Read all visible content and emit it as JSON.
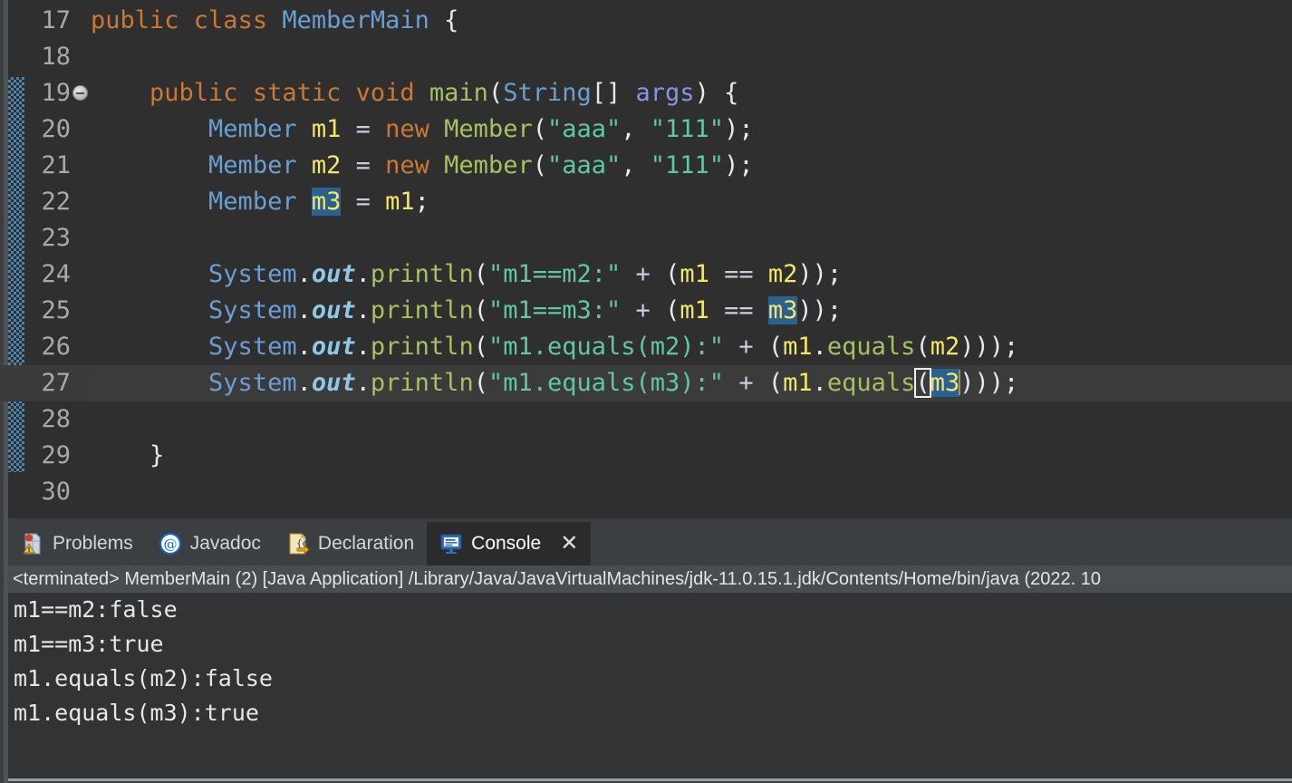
{
  "editor": {
    "lines": [
      {
        "num": "17",
        "fold": false,
        "current": false,
        "tokens": [
          {
            "t": "public ",
            "c": "kw"
          },
          {
            "t": "class ",
            "c": "kw"
          },
          {
            "t": "MemberMain",
            "c": "type"
          },
          {
            "t": " {",
            "c": "plain"
          }
        ]
      },
      {
        "num": "18",
        "fold": false,
        "current": false,
        "tokens": []
      },
      {
        "num": "19",
        "fold": true,
        "current": false,
        "tokens": [
          {
            "t": "    ",
            "c": "plain"
          },
          {
            "t": "public ",
            "c": "kw"
          },
          {
            "t": "static ",
            "c": "kw"
          },
          {
            "t": "void ",
            "c": "kw"
          },
          {
            "t": "main",
            "c": "method"
          },
          {
            "t": "(",
            "c": "plain"
          },
          {
            "t": "String",
            "c": "type"
          },
          {
            "t": "[] ",
            "c": "plain"
          },
          {
            "t": "args",
            "c": "param"
          },
          {
            "t": ") {",
            "c": "plain"
          }
        ]
      },
      {
        "num": "20",
        "fold": false,
        "current": false,
        "tokens": [
          {
            "t": "        ",
            "c": "plain"
          },
          {
            "t": "Member ",
            "c": "type"
          },
          {
            "t": "m1",
            "c": "var"
          },
          {
            "t": " = ",
            "c": "op"
          },
          {
            "t": "new ",
            "c": "kw"
          },
          {
            "t": "Member",
            "c": "method"
          },
          {
            "t": "(",
            "c": "plain"
          },
          {
            "t": "\"aaa\"",
            "c": "str"
          },
          {
            "t": ", ",
            "c": "plain"
          },
          {
            "t": "\"111\"",
            "c": "str"
          },
          {
            "t": ");",
            "c": "plain"
          }
        ]
      },
      {
        "num": "21",
        "fold": false,
        "current": false,
        "tokens": [
          {
            "t": "        ",
            "c": "plain"
          },
          {
            "t": "Member ",
            "c": "type"
          },
          {
            "t": "m2",
            "c": "var"
          },
          {
            "t": " = ",
            "c": "op"
          },
          {
            "t": "new ",
            "c": "kw"
          },
          {
            "t": "Member",
            "c": "method"
          },
          {
            "t": "(",
            "c": "plain"
          },
          {
            "t": "\"aaa\"",
            "c": "str"
          },
          {
            "t": ", ",
            "c": "plain"
          },
          {
            "t": "\"111\"",
            "c": "str"
          },
          {
            "t": ");",
            "c": "plain"
          }
        ]
      },
      {
        "num": "22",
        "fold": false,
        "current": false,
        "tokens": [
          {
            "t": "        ",
            "c": "plain"
          },
          {
            "t": "Member ",
            "c": "type"
          },
          {
            "t": "m3",
            "c": "var",
            "hl": "occ"
          },
          {
            "t": " = ",
            "c": "op"
          },
          {
            "t": "m1",
            "c": "var"
          },
          {
            "t": ";",
            "c": "plain"
          }
        ]
      },
      {
        "num": "23",
        "fold": false,
        "current": false,
        "tokens": []
      },
      {
        "num": "24",
        "fold": false,
        "current": false,
        "tokens": [
          {
            "t": "        ",
            "c": "plain"
          },
          {
            "t": "System",
            "c": "type"
          },
          {
            "t": ".",
            "c": "plain"
          },
          {
            "t": "out",
            "c": "field"
          },
          {
            "t": ".",
            "c": "plain"
          },
          {
            "t": "println",
            "c": "method"
          },
          {
            "t": "(",
            "c": "plain"
          },
          {
            "t": "\"m1==m2:\"",
            "c": "str"
          },
          {
            "t": " ",
            "c": "plain"
          },
          {
            "t": "+",
            "c": "op"
          },
          {
            "t": " (",
            "c": "plain"
          },
          {
            "t": "m1",
            "c": "var"
          },
          {
            "t": " ",
            "c": "plain"
          },
          {
            "t": "==",
            "c": "op"
          },
          {
            "t": " ",
            "c": "plain"
          },
          {
            "t": "m2",
            "c": "var"
          },
          {
            "t": "));",
            "c": "plain"
          }
        ]
      },
      {
        "num": "25",
        "fold": false,
        "current": false,
        "tokens": [
          {
            "t": "        ",
            "c": "plain"
          },
          {
            "t": "System",
            "c": "type"
          },
          {
            "t": ".",
            "c": "plain"
          },
          {
            "t": "out",
            "c": "field"
          },
          {
            "t": ".",
            "c": "plain"
          },
          {
            "t": "println",
            "c": "method"
          },
          {
            "t": "(",
            "c": "plain"
          },
          {
            "t": "\"m1==m3:\"",
            "c": "str"
          },
          {
            "t": " ",
            "c": "plain"
          },
          {
            "t": "+",
            "c": "op"
          },
          {
            "t": " (",
            "c": "plain"
          },
          {
            "t": "m1",
            "c": "var"
          },
          {
            "t": " ",
            "c": "plain"
          },
          {
            "t": "==",
            "c": "op"
          },
          {
            "t": " ",
            "c": "plain"
          },
          {
            "t": "m3",
            "c": "var",
            "hl": "occ"
          },
          {
            "t": "));",
            "c": "plain"
          }
        ]
      },
      {
        "num": "26",
        "fold": false,
        "current": false,
        "tokens": [
          {
            "t": "        ",
            "c": "plain"
          },
          {
            "t": "System",
            "c": "type"
          },
          {
            "t": ".",
            "c": "plain"
          },
          {
            "t": "out",
            "c": "field"
          },
          {
            "t": ".",
            "c": "plain"
          },
          {
            "t": "println",
            "c": "method"
          },
          {
            "t": "(",
            "c": "plain"
          },
          {
            "t": "\"m1.equals(m2):\"",
            "c": "str"
          },
          {
            "t": " ",
            "c": "plain"
          },
          {
            "t": "+",
            "c": "op"
          },
          {
            "t": " (",
            "c": "plain"
          },
          {
            "t": "m1",
            "c": "var"
          },
          {
            "t": ".",
            "c": "plain"
          },
          {
            "t": "equals",
            "c": "method"
          },
          {
            "t": "(",
            "c": "plain"
          },
          {
            "t": "m2",
            "c": "var"
          },
          {
            "t": ")));",
            "c": "plain"
          }
        ]
      },
      {
        "num": "27",
        "fold": false,
        "current": true,
        "tokens": [
          {
            "t": "        ",
            "c": "plain"
          },
          {
            "t": "System",
            "c": "type"
          },
          {
            "t": ".",
            "c": "plain"
          },
          {
            "t": "out",
            "c": "field"
          },
          {
            "t": ".",
            "c": "plain"
          },
          {
            "t": "println",
            "c": "method"
          },
          {
            "t": "(",
            "c": "plain"
          },
          {
            "t": "\"m1.equals(m3):\"",
            "c": "str"
          },
          {
            "t": " ",
            "c": "plain"
          },
          {
            "t": "+",
            "c": "op"
          },
          {
            "t": " (",
            "c": "plain"
          },
          {
            "t": "m1",
            "c": "var"
          },
          {
            "t": ".",
            "c": "plain"
          },
          {
            "t": "equals",
            "c": "method"
          },
          {
            "t": "(",
            "c": "plain",
            "hl": "brmatch"
          },
          {
            "t": "m3",
            "c": "var",
            "hl": "sel"
          },
          {
            "t": "",
            "c": "caret"
          },
          {
            "t": ")));",
            "c": "plain"
          }
        ]
      },
      {
        "num": "28",
        "fold": false,
        "current": false,
        "tokens": []
      },
      {
        "num": "29",
        "fold": false,
        "current": false,
        "tokens": [
          {
            "t": "    }",
            "c": "plain"
          }
        ]
      },
      {
        "num": "30",
        "fold": false,
        "current": false,
        "tokens": []
      }
    ]
  },
  "panel": {
    "tabs": [
      {
        "label": "Problems",
        "icon": "problems-icon",
        "active": false,
        "closable": false
      },
      {
        "label": "Javadoc",
        "icon": "javadoc-icon",
        "active": false,
        "closable": false
      },
      {
        "label": "Declaration",
        "icon": "declaration-icon",
        "active": false,
        "closable": false
      },
      {
        "label": "Console",
        "icon": "console-icon",
        "active": true,
        "closable": true,
        "close_label": "✕"
      }
    ],
    "status": "<terminated> MemberMain (2) [Java Application] /Library/Java/JavaVirtualMachines/jdk-11.0.15.1.jdk/Contents/Home/bin/java  (2022. 10",
    "output": [
      "m1==m2:false",
      "m1==m3:true",
      "m1.equals(m2):false",
      "m1.equals(m3):true"
    ]
  },
  "colors": {
    "editor_bg": "#2f2f2f",
    "panel_bg": "#3c3f41",
    "console_bg": "#313335",
    "selection": "#2b6190",
    "change_bar": "#4a83ad",
    "keyword": "#cc7832",
    "type": "#6a9fd4",
    "variable": "#f5e663",
    "method": "#a5c261",
    "string": "#5fc9a0"
  }
}
